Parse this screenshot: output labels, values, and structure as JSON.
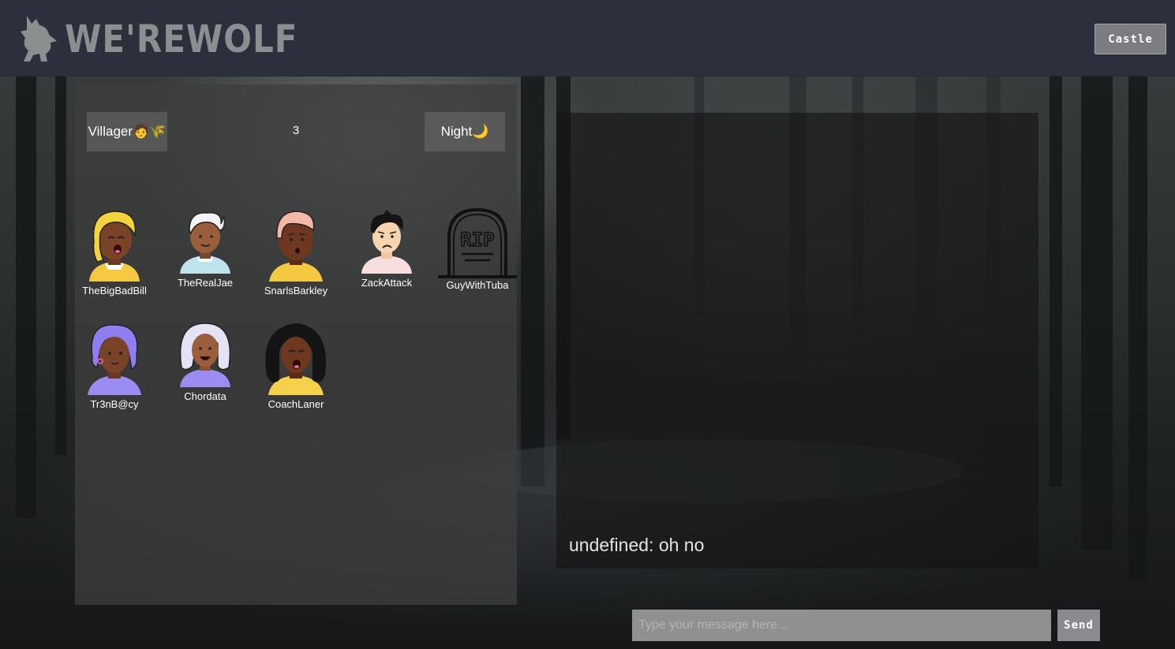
{
  "header": {
    "logo_text": "WE'REWOLF",
    "castle_button": "Castle"
  },
  "game": {
    "role_label": "Villager🧑🌾",
    "round": "3",
    "phase_label": "Night🌙",
    "players": [
      {
        "name": "TheBigBadBill",
        "avatar": "avatar-yellow-hair-open-mouth",
        "alive": true
      },
      {
        "name": "TheRealJae",
        "avatar": "avatar-white-hair-smile",
        "alive": true
      },
      {
        "name": "SnarlsBarkley",
        "avatar": "avatar-pink-hair-surprised",
        "alive": true
      },
      {
        "name": "ZackAttack",
        "avatar": "avatar-black-hair-sad",
        "alive": true
      },
      {
        "name": "GuyWithTuba",
        "avatar": "rip-tombstone-icon",
        "alive": false
      },
      {
        "name": "Tr3nB@cy",
        "avatar": "avatar-purple-hair-earring",
        "alive": true
      },
      {
        "name": "Chordata",
        "avatar": "avatar-lavender-hair-laugh",
        "alive": true
      },
      {
        "name": "CoachLaner",
        "avatar": "avatar-black-curly-hair-open-mouth",
        "alive": true
      }
    ],
    "tombstone_text": "RIP"
  },
  "chat": {
    "messages": [
      {
        "text": "undefined: oh no"
      }
    ],
    "input_placeholder": "Type your message here...",
    "input_value": "",
    "send_button": "Send"
  },
  "colors": {
    "header_bg": "#2b303c",
    "panel_bg": "#3e3e3e",
    "button_bg": "#7b7d80"
  }
}
